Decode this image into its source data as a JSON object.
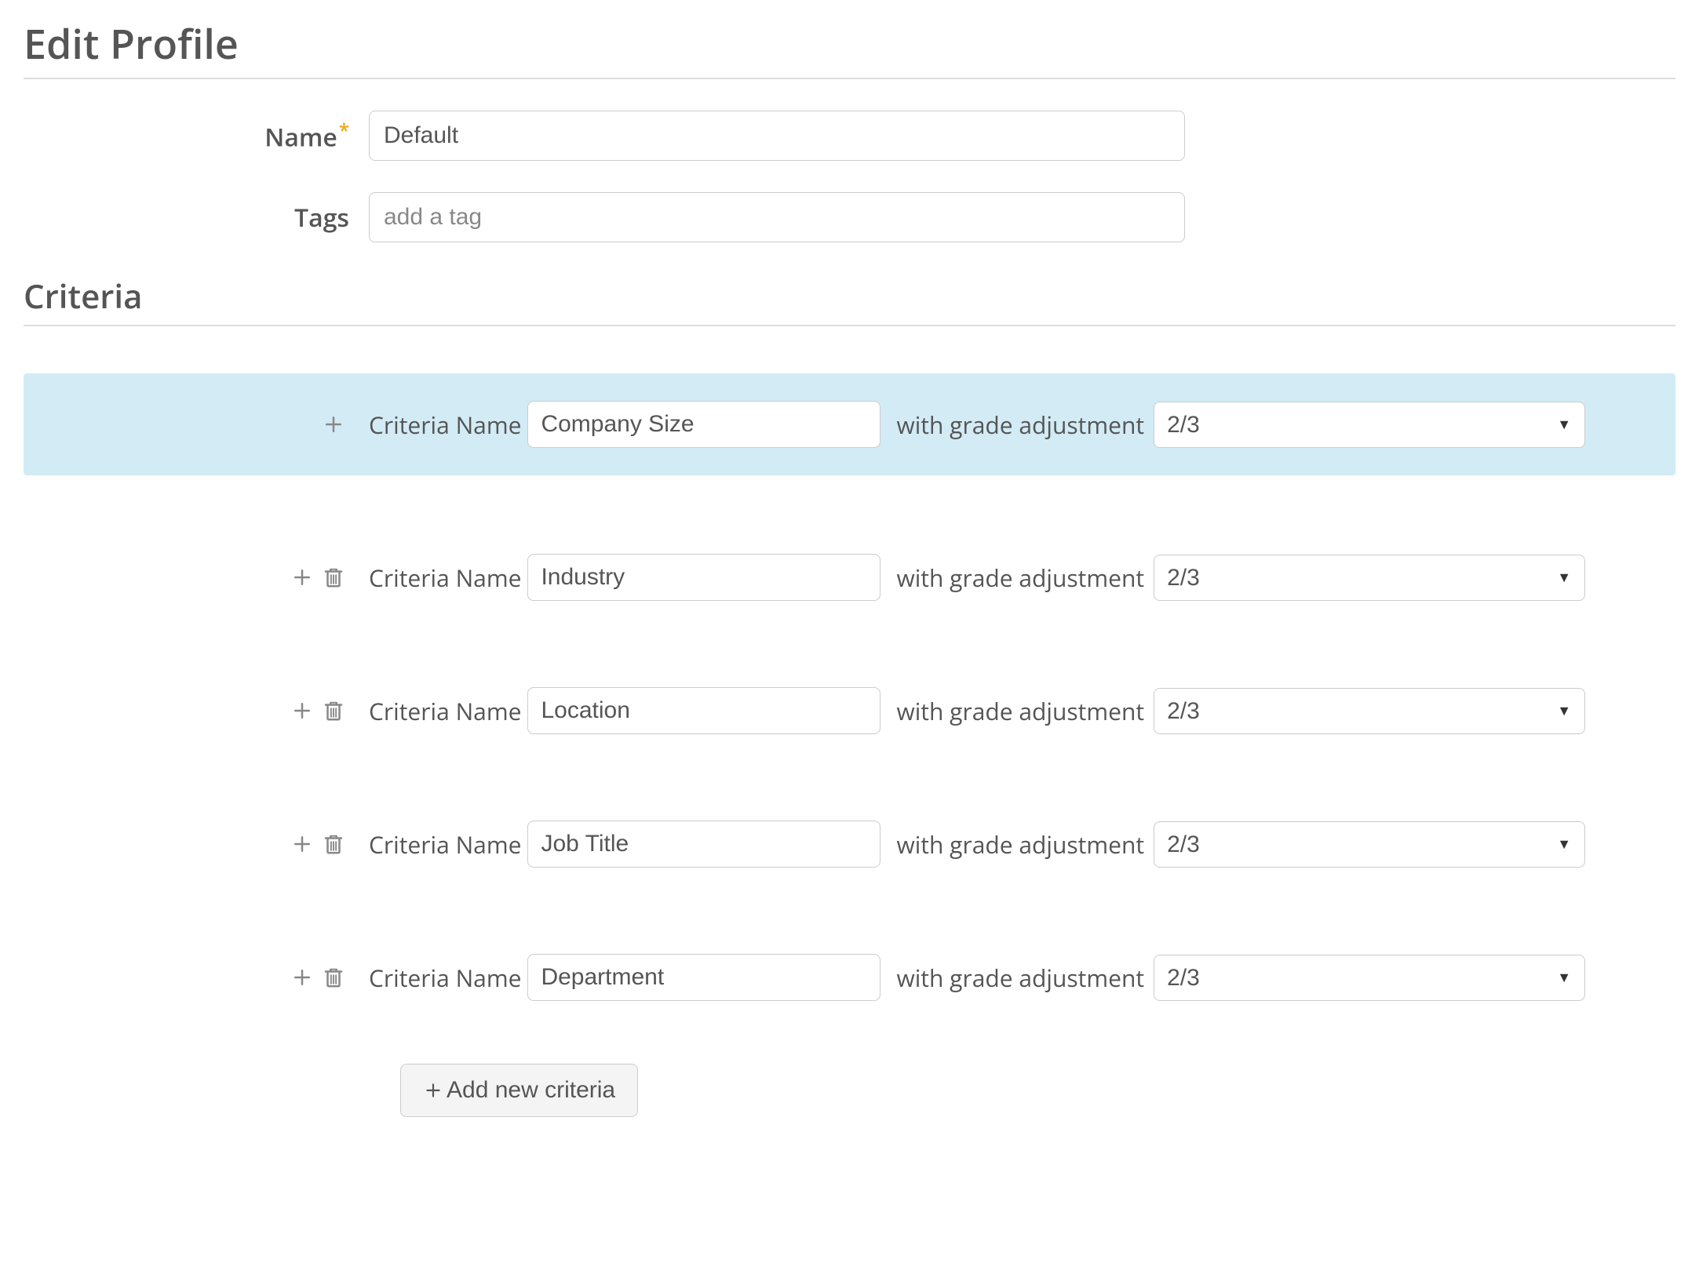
{
  "page": {
    "title": "Edit Profile"
  },
  "fields": {
    "name_label": "Name",
    "name_value": "Default",
    "tags_label": "Tags",
    "tags_placeholder": "add a tag"
  },
  "criteria_section": {
    "heading": "Criteria",
    "name_label": "Criteria Name",
    "adjust_label": "with grade adjustment",
    "rows": [
      {
        "name": "Company Size",
        "grade": "2/3",
        "highlight": true,
        "deletable": false
      },
      {
        "name": "Industry",
        "grade": "2/3",
        "highlight": false,
        "deletable": true
      },
      {
        "name": "Location",
        "grade": "2/3",
        "highlight": false,
        "deletable": true
      },
      {
        "name": "Job Title",
        "grade": "2/3",
        "highlight": false,
        "deletable": true
      },
      {
        "name": "Department",
        "grade": "2/3",
        "highlight": false,
        "deletable": true
      }
    ],
    "add_button_label": "Add new criteria"
  }
}
